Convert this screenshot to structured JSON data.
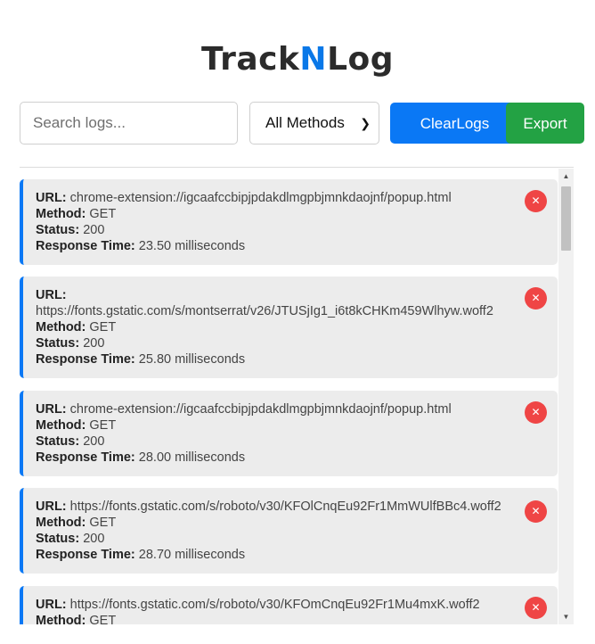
{
  "header": {
    "title_part1": "Track",
    "title_accent": "N",
    "title_part2": "Log"
  },
  "toolbar": {
    "search_placeholder": "Search logs...",
    "method_filter_selected": "All Methods",
    "clear_label": "ClearLogs",
    "export_label": "Export"
  },
  "labels": {
    "url": "URL:",
    "method": "Method:",
    "status": "Status:",
    "response_time": "Response Time:"
  },
  "logs": [
    {
      "url": "chrome-extension://igcaafccbipjpdakdlmgpbjmnkdaojnf/popup.html",
      "method": "GET",
      "status": "200",
      "response_time": "23.50 milliseconds"
    },
    {
      "url": "https://fonts.gstatic.com/s/montserrat/v26/JTUSjIg1_i6t8kCHKm459Wlhyw.woff2",
      "method": "GET",
      "status": "200",
      "response_time": "25.80 milliseconds"
    },
    {
      "url": "chrome-extension://igcaafccbipjpdakdlmgpbjmnkdaojnf/popup.html",
      "method": "GET",
      "status": "200",
      "response_time": "28.00 milliseconds"
    },
    {
      "url": "https://fonts.gstatic.com/s/roboto/v30/KFOlCnqEu92Fr1MmWUlfBBc4.woff2",
      "method": "GET",
      "status": "200",
      "response_time": "28.70 milliseconds"
    },
    {
      "url": "https://fonts.gstatic.com/s/roboto/v30/KFOmCnqEu92Fr1Mu4mxK.woff2",
      "method": "GET",
      "status": "",
      "response_time": ""
    }
  ],
  "icons": {
    "delete": "close-icon",
    "select_arrow": "chevron-down-icon"
  },
  "colors": {
    "accent": "#0a78f5",
    "clear_button": "#0a78f5",
    "export_button": "#23a244",
    "delete_button": "#ef4545",
    "card_bg": "#ececec"
  }
}
